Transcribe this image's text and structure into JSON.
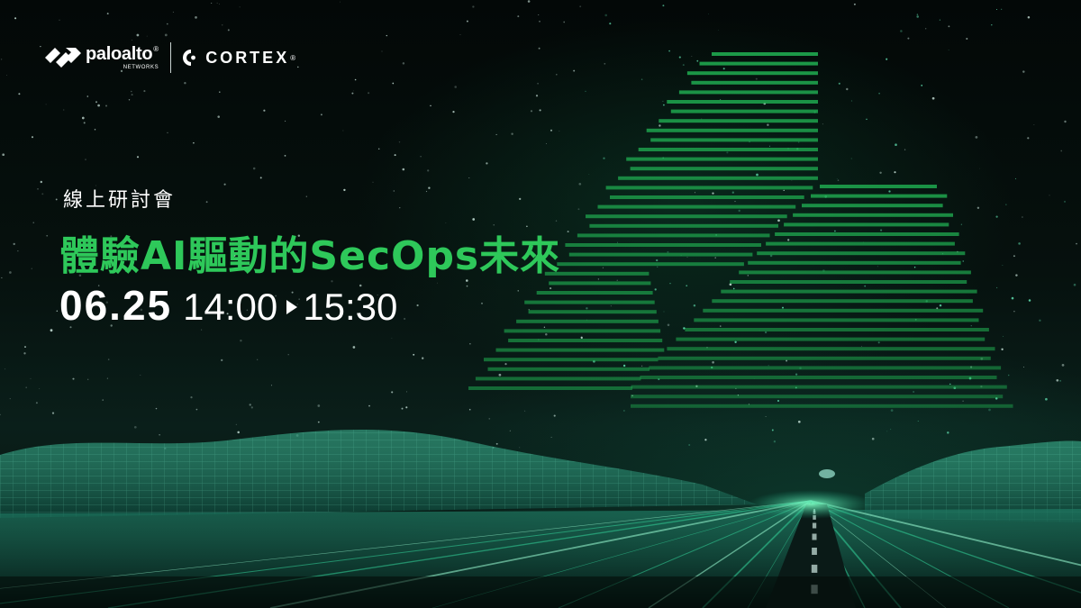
{
  "brand": {
    "paloalto_name": "paloalto",
    "paloalto_sub": "NETWORKS",
    "registered_mark": "®",
    "cortex_name": "CORTEX"
  },
  "event": {
    "kicker": "線上研討會",
    "title": "體驗AI驅動的SecOps未來",
    "date": "06.25",
    "time_start": "14:00",
    "time_end": "15:30"
  },
  "colors": {
    "accent_green": "#2ec85a",
    "background": "#050b0a",
    "text": "#ffffff"
  },
  "icons": [
    "paloalto-logo-icon",
    "cortex-logo-icon",
    "play-arrow-icon"
  ]
}
